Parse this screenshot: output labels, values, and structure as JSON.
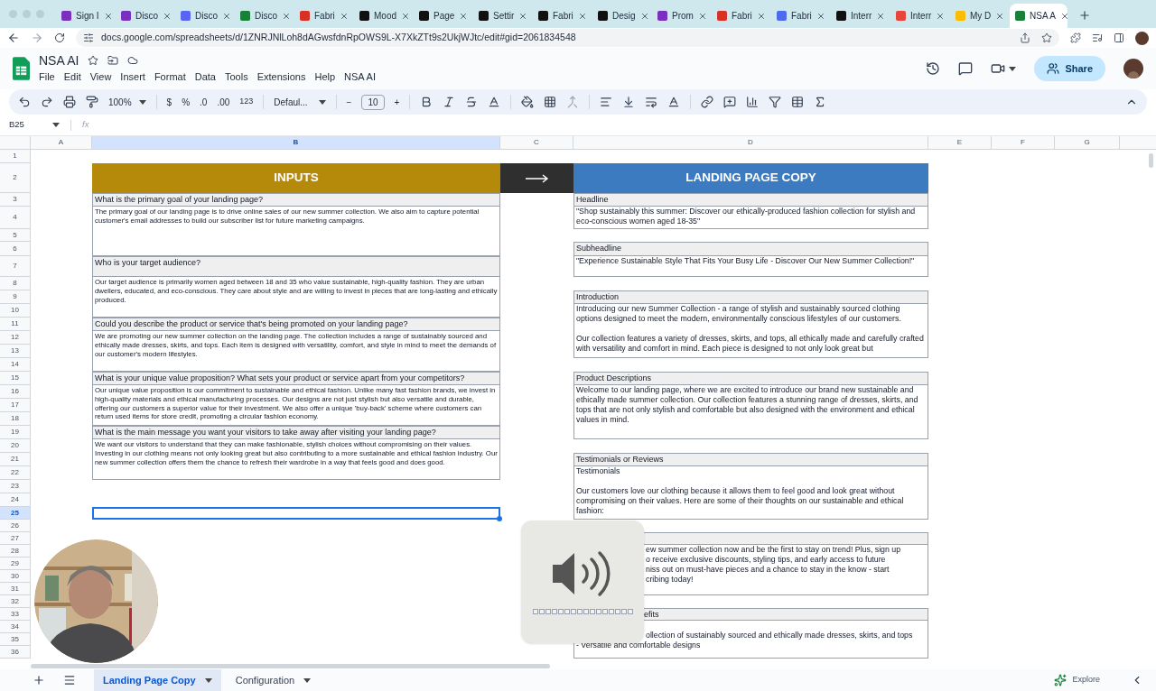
{
  "browser": {
    "tabs": [
      {
        "label": "Sign I",
        "color": "#7b2fbe",
        "selected": false
      },
      {
        "label": "Disco",
        "color": "#7b2fbe",
        "selected": false
      },
      {
        "label": "Disco",
        "color": "#5865f2",
        "selected": false
      },
      {
        "label": "Disco",
        "color": "#188038",
        "selected": false
      },
      {
        "label": "Fabri",
        "color": "#d93025",
        "selected": false
      },
      {
        "label": "Mood",
        "color": "#111111",
        "selected": false
      },
      {
        "label": "Page",
        "color": "#111111",
        "selected": false
      },
      {
        "label": "Settir",
        "color": "#111111",
        "selected": false
      },
      {
        "label": "Fabri",
        "color": "#111111",
        "selected": false
      },
      {
        "label": "Desig",
        "color": "#111111",
        "selected": false
      },
      {
        "label": "Prom",
        "color": "#7b2fbe",
        "selected": false
      },
      {
        "label": "Fabri",
        "color": "#d93025",
        "selected": false
      },
      {
        "label": "Fabri",
        "color": "#4f6bed",
        "selected": false
      },
      {
        "label": "Interr",
        "color": "#111111",
        "selected": false
      },
      {
        "label": "Interr",
        "color": "#e8453c",
        "selected": false
      },
      {
        "label": "My D",
        "color": "#fbbc04",
        "selected": false
      },
      {
        "label": "NSA A",
        "color": "#188038",
        "selected": true
      }
    ],
    "url": "docs.google.com/spreadsheets/d/1ZNRJNlLoh8dAGwsfdnRpOWS9L-X7XkZTt9s2UkjWJtc/edit#gid=2061834548"
  },
  "doc": {
    "title": "NSA AI",
    "menus": [
      "File",
      "Edit",
      "View",
      "Insert",
      "Format",
      "Data",
      "Tools",
      "Extensions",
      "Help",
      "NSA AI"
    ],
    "share": "Share"
  },
  "toolbar": {
    "zoom": "100%",
    "currency": "$",
    "percent": "%",
    "decrease_decimals": ".0",
    "increase_decimals": ".00",
    "number_format": "123",
    "font": "Defaul...",
    "font_minus": "−",
    "font_size": "10",
    "font_plus": "+"
  },
  "formula_bar": {
    "cell_ref": "B25",
    "fx": "fx"
  },
  "columns": [
    {
      "label": "A",
      "selected": false
    },
    {
      "label": "B",
      "selected": true
    },
    {
      "label": "C",
      "selected": false
    },
    {
      "label": "D",
      "selected": false
    },
    {
      "label": "E",
      "selected": false
    },
    {
      "label": "F",
      "selected": false
    },
    {
      "label": "G",
      "selected": false
    }
  ],
  "rows": [
    {
      "label": "1",
      "selected": false
    },
    {
      "label": "2",
      "selected": false
    },
    {
      "label": "3",
      "selected": false
    },
    {
      "label": "4",
      "selected": false
    },
    {
      "label": "5",
      "selected": false
    },
    {
      "label": "6",
      "selected": false
    },
    {
      "label": "7",
      "selected": false
    },
    {
      "label": "8",
      "selected": false
    },
    {
      "label": "9",
      "selected": false
    },
    {
      "label": "10",
      "selected": false
    },
    {
      "label": "11",
      "selected": false
    },
    {
      "label": "12",
      "selected": false
    },
    {
      "label": "13",
      "selected": false
    },
    {
      "label": "14",
      "selected": false
    },
    {
      "label": "15",
      "selected": false
    },
    {
      "label": "16",
      "selected": false
    },
    {
      "label": "17",
      "selected": false
    },
    {
      "label": "18",
      "selected": false
    },
    {
      "label": "19",
      "selected": false
    },
    {
      "label": "20",
      "selected": false
    },
    {
      "label": "21",
      "selected": false
    },
    {
      "label": "22",
      "selected": false
    },
    {
      "label": "23",
      "selected": false
    },
    {
      "label": "24",
      "selected": false
    },
    {
      "label": "25",
      "selected": true
    },
    {
      "label": "26",
      "selected": false
    },
    {
      "label": "27",
      "selected": false
    },
    {
      "label": "28",
      "selected": false
    },
    {
      "label": "29",
      "selected": false
    },
    {
      "label": "30",
      "selected": false
    },
    {
      "label": "31",
      "selected": false
    },
    {
      "label": "32",
      "selected": false
    },
    {
      "label": "33",
      "selected": false
    },
    {
      "label": "34",
      "selected": false
    },
    {
      "label": "35",
      "selected": false
    },
    {
      "label": "36",
      "selected": false
    }
  ],
  "inputs": {
    "title": "INPUTS",
    "items": [
      {
        "question": "What is the primary goal of your landing page?",
        "answer": "The primary goal of our landing page is to drive online sales of our new summer collection. We also aim to capture potential customer's email addresses to build our subscriber list for future marketing campaigns."
      },
      {
        "question": "Who is your target audience?",
        "answer": "Our target audience is primarily women aged between 18 and 35 who value sustainable, high-quality fashion. They are urban dwellers, educated, and eco-conscious. They care about style and are willing to invest in pieces that are long-lasting and ethically produced."
      },
      {
        "question": "Could you describe the product or service that's being promoted on your landing page?",
        "answer": "We are promoting our new summer collection on the landing page. The collection includes a range of sustainably sourced and ethically made dresses, skirts, and tops. Each item is designed with versatility, comfort, and style in mind to meet the demands of our customer's modern lifestyles."
      },
      {
        "question": "What is your unique value proposition? What sets your product or service apart from your competitors?",
        "answer": "Our unique value proposition is our commitment to sustainable and ethical fashion. Unlike many fast fashion brands, we invest in high-quality materials and ethical manufacturing processes. Our designs are not just stylish but also versatile and durable, offering our customers a superior value for their investment. We also offer a unique 'buy-back' scheme where customers can return used items for store credit, promoting a circular fashion economy."
      },
      {
        "question": "What is the main message you want your visitors to take away after visiting your landing page?",
        "answer": "We want our visitors to understand that they can make fashionable, stylish choices without compromising on their values. Investing in our clothing means not only looking great but also contributing to a more sustainable and ethical fashion industry. Our new summer collection offers them the chance to refresh their wardrobe in a way that feels good and does good."
      }
    ]
  },
  "copy": {
    "title": "LANDING PAGE COPY",
    "sections": [
      {
        "kind": "full",
        "label": "Headline",
        "lines": [
          {
            "text": "\"Shop sustainably this summer: Discover our ethically-produced fashion collection for stylish and eco-conscious women aged 18-35\"",
            "covered": false
          }
        ]
      },
      {
        "kind": "full",
        "label": "Subheadline",
        "lines": [
          {
            "text": "\"Experience Sustainable Style That Fits Your Busy Life - Discover Our New Summer Collection!\"",
            "covered": false
          }
        ]
      },
      {
        "kind": "full",
        "label": "Introduction",
        "lines": [
          {
            "text": "Introducing our new Summer Collection - a range of stylish and sustainably sourced clothing options designed to meet the modern, environmentally conscious lifestyles of our customers.",
            "covered": false
          },
          {
            "text": "Our collection features a variety of dresses, skirts, and tops, all ethically made and carefully crafted with versatility and comfort in mind. Each piece is designed to not only look great but",
            "covered": false
          }
        ]
      },
      {
        "kind": "full",
        "label": "Product Descriptions",
        "lines": [
          {
            "text": "Welcome to our landing page, where we are excited to introduce our brand new sustainable and ethically made summer collection. Our collection features a stunning range of dresses, skirts, and tops that are not only stylish and comfortable but also designed with the environment and ethical values in mind.",
            "covered": false
          }
        ]
      },
      {
        "kind": "full",
        "label": "Testimonials or Reviews",
        "lines": [
          {
            "text": "Testimonials",
            "covered": false
          },
          {
            "text": "Our customers love our clothing because it allows them to feel good and look great without compromising on their values. Here are some of their thoughts on our sustainable and ethical fashion:",
            "covered": false
          }
        ]
      },
      {
        "kind": "covered",
        "lines": [
          {
            "text": "ew summer collection now and be the first to stay on trend! Plus, sign up",
            "covered": true
          },
          {
            "text": "o receive exclusive discounts, styling tips, and early access to future",
            "covered": true
          },
          {
            "text": "niss out on must-have pieces and a chance to stay in the know - start",
            "covered": true
          },
          {
            "text": "cribing today!",
            "covered": true
          }
        ]
      },
      {
        "kind": "covered",
        "label": "efits",
        "lines": [
          {
            "text": "ollection of sustainably sourced and ethically made dresses, skirts, and tops",
            "covered": true
          },
          {
            "text": "- Versatile and comfortable designs",
            "covered": false
          }
        ]
      }
    ]
  },
  "sheet_tabs": [
    {
      "label": "Landing Page Copy",
      "selected": true
    },
    {
      "label": "Configuration",
      "selected": false
    }
  ],
  "explore": "Explore"
}
